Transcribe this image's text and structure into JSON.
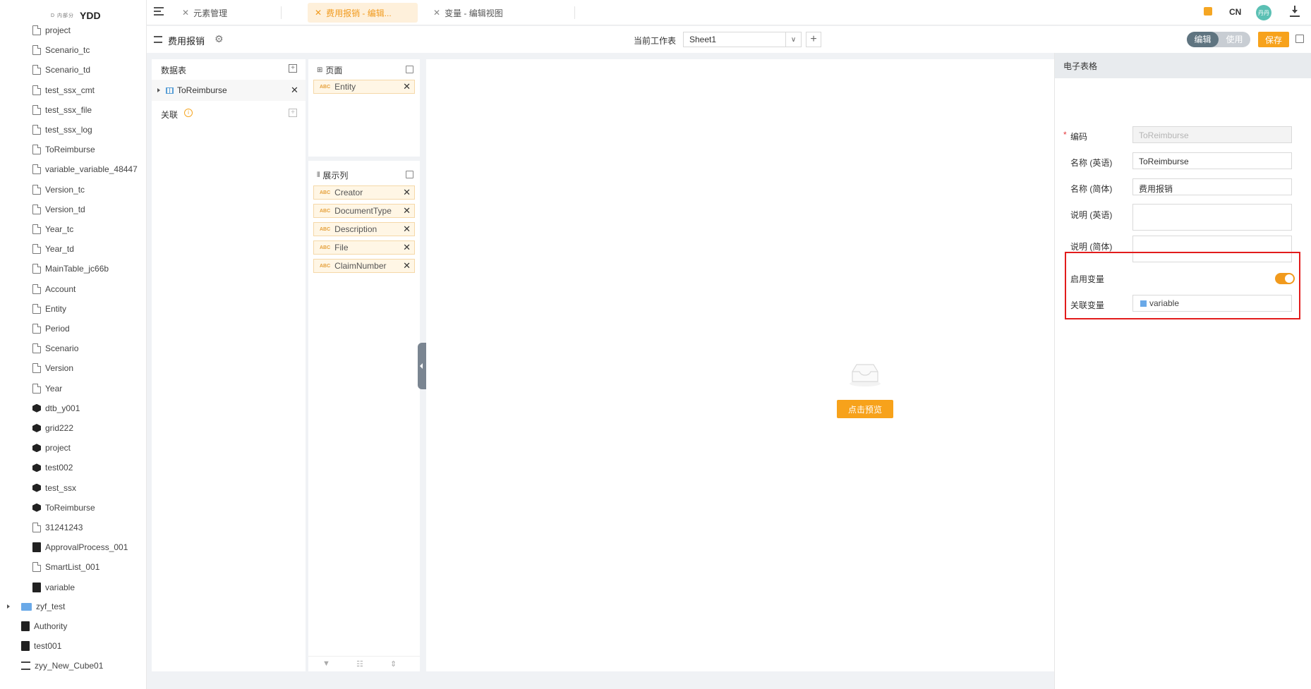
{
  "brand": {
    "mark": "D 内部分",
    "name": "YDD"
  },
  "sidebar": {
    "items": [
      {
        "label": "project",
        "icon": "document-icon"
      },
      {
        "label": "Scenario_tc",
        "icon": "document-icon"
      },
      {
        "label": "Scenario_td",
        "icon": "document-icon"
      },
      {
        "label": "test_ssx_cmt",
        "icon": "document-icon"
      },
      {
        "label": "test_ssx_file",
        "icon": "document-icon"
      },
      {
        "label": "test_ssx_log",
        "icon": "document-icon"
      },
      {
        "label": "ToReimburse",
        "icon": "document-icon"
      },
      {
        "label": "variable_variable_48447",
        "icon": "document-icon"
      },
      {
        "label": "Version_tc",
        "icon": "document-icon"
      },
      {
        "label": "Version_td",
        "icon": "document-icon"
      },
      {
        "label": "Year_tc",
        "icon": "document-icon"
      },
      {
        "label": "Year_td",
        "icon": "document-icon"
      },
      {
        "label": "MainTable_jc66b",
        "icon": "document-icon"
      },
      {
        "label": "Account",
        "icon": "document-icon"
      },
      {
        "label": "Entity",
        "icon": "document-icon"
      },
      {
        "label": "Period",
        "icon": "document-icon"
      },
      {
        "label": "Scenario",
        "icon": "document-icon"
      },
      {
        "label": "Version",
        "icon": "document-icon"
      },
      {
        "label": "Year",
        "icon": "document-icon"
      },
      {
        "label": "dtb_y001",
        "icon": "cube-icon"
      },
      {
        "label": "grid222",
        "icon": "cube-icon"
      },
      {
        "label": "project",
        "icon": "cube-icon"
      },
      {
        "label": "test002",
        "icon": "cube-icon"
      },
      {
        "label": "test_ssx",
        "icon": "cube-icon"
      },
      {
        "label": "ToReimburse",
        "icon": "cube-icon"
      },
      {
        "label": "31241243",
        "icon": "document-icon"
      },
      {
        "label": "ApprovalProcess_001",
        "icon": "approval-icon"
      },
      {
        "label": "SmartList_001",
        "icon": "document-icon"
      },
      {
        "label": "variable",
        "icon": "variable-icon"
      }
    ],
    "root_items": [
      {
        "label": "zyf_test",
        "icon": "folder-icon"
      },
      {
        "label": "Authority",
        "icon": "authority-icon"
      },
      {
        "label": "test001",
        "icon": "document-dark-icon"
      },
      {
        "label": "zyy_New_Cube01",
        "icon": "org-icon"
      }
    ]
  },
  "tabs": [
    {
      "label": "元素管理",
      "active": false
    },
    {
      "label": "费用报销 - 编辑...",
      "active": true
    },
    {
      "label": "变量 - 编辑视图",
      "active": false
    }
  ],
  "topright": {
    "lang": "CN",
    "avatar": "丹丹"
  },
  "toolbar": {
    "title": "费用报销",
    "sheet_label": "当前工作表",
    "sheet_value": "Sheet1",
    "mode_edit": "编辑",
    "mode_use": "使用",
    "save_label": "保存"
  },
  "data_panel": {
    "header": "数据表",
    "table_name": "ToReimburse",
    "relation_header": "关联"
  },
  "columns_panel": {
    "page_header": "页面",
    "page_items": [
      "Entity"
    ],
    "columns_header": "展示列",
    "column_items": [
      "Creator",
      "DocumentType",
      "Description",
      "File",
      "ClaimNumber"
    ],
    "chip_prefix": "ABC"
  },
  "canvas": {
    "preview_label": "点击预览"
  },
  "properties": {
    "header": "电子表格",
    "code_label": "编码",
    "code_value": "ToReimburse",
    "name_en_label": "名称 (英语)",
    "name_en_value": "ToReimburse",
    "name_cn_label": "名称 (简体)",
    "name_cn_value": "费用报销",
    "desc_en_label": "说明 (英语)",
    "desc_cn_label": "说明 (简体)",
    "enable_var_label": "启用变量",
    "enable_var_on": true,
    "link_var_label": "关联变量",
    "link_var_value": "variable"
  },
  "colors": {
    "accent": "#f7a21b",
    "highlight": "#e21c1c",
    "mode_active": "#5f7480"
  }
}
